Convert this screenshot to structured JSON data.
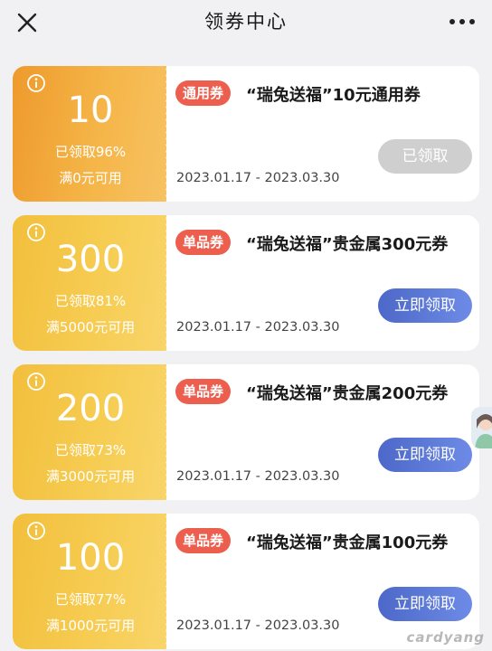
{
  "header": {
    "title": "领券中心"
  },
  "coupons": [
    {
      "amount": "10",
      "claimed": "已领取96%",
      "minimum": "满0元可用",
      "badge": "通用券",
      "title": "“瑞兔送福”10元通用券",
      "dates": "2023.01.17 - 2023.03.30",
      "action": "已领取",
      "action_state": "claimed",
      "stub_color": "#f0a535"
    },
    {
      "amount": "300",
      "claimed": "已领取81%",
      "minimum": "满5000元可用",
      "badge": "单品券",
      "title": "“瑞兔送福”贵金属300元券",
      "dates": "2023.01.17 - 2023.03.30",
      "action": "立即领取",
      "action_state": "available",
      "stub_color": "#f4c74a"
    },
    {
      "amount": "200",
      "claimed": "已领取73%",
      "minimum": "满3000元可用",
      "badge": "单品券",
      "title": "“瑞兔送福”贵金属200元券",
      "dates": "2023.01.17 - 2023.03.30",
      "action": "立即领取",
      "action_state": "available",
      "stub_color": "#f4c74a"
    },
    {
      "amount": "100",
      "claimed": "已领取77%",
      "minimum": "满1000元可用",
      "badge": "单品券",
      "title": "“瑞兔送福”贵金属100元券",
      "dates": "2023.01.17 - 2023.03.30",
      "action": "立即领取",
      "action_state": "available",
      "stub_color": "#f4c74a"
    }
  ],
  "colors": {
    "badge": "#ec5f4f",
    "claim_button": "#5a76d6",
    "claimed_button": "#cfcfcf",
    "background": "#f1f1f3"
  },
  "watermark": "cardyang"
}
